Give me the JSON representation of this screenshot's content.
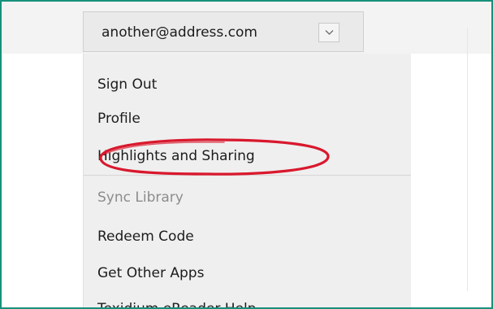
{
  "account": {
    "email": "another@address.com"
  },
  "menu": {
    "items": [
      {
        "label": "Sign Out",
        "enabled": true
      },
      {
        "label": "Profile",
        "enabled": true
      },
      {
        "label": "Highlights and Sharing",
        "enabled": true
      },
      {
        "label": "Sync Library",
        "enabled": false
      },
      {
        "label": "Redeem Code",
        "enabled": true
      },
      {
        "label": "Get Other Apps",
        "enabled": true
      },
      {
        "label": "Texidium eReader Help",
        "enabled": true
      }
    ]
  },
  "colors": {
    "frame_border": "#17907b",
    "annotation_ring": "#d9182d",
    "menu_background": "#efefef",
    "disabled_text": "#8c8c8c"
  },
  "icons": {
    "dropdown": "chevron-down-icon"
  }
}
